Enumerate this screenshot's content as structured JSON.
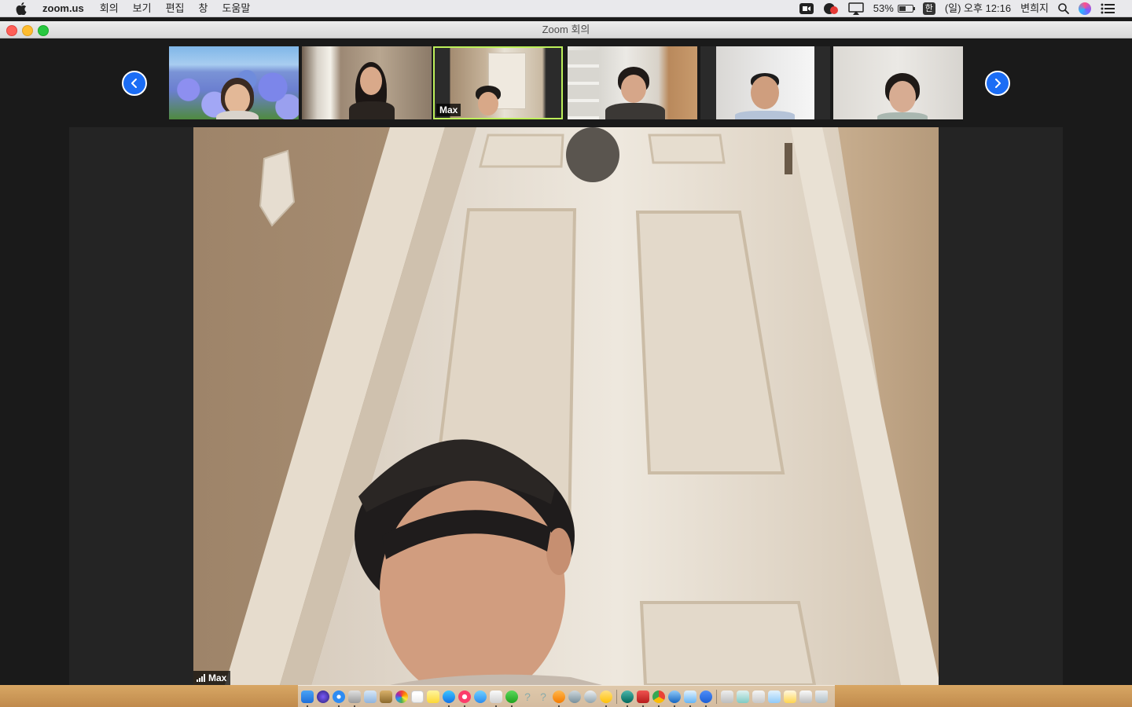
{
  "menubar": {
    "app_name": "zoom.us",
    "menus": [
      "회의",
      "보기",
      "편집",
      "창",
      "도움말"
    ],
    "battery_percent": "53%",
    "battery_level": 0.53,
    "input_method": "한",
    "clock": "(일) 오후 12:16",
    "user": "변희지"
  },
  "window": {
    "title": "Zoom 회의"
  },
  "gallery": {
    "active_participant": "Max"
  },
  "main_video": {
    "speaker_name": "Max"
  },
  "colors": {
    "accent_blue": "#1b6df5",
    "active_speaker_border": "#bdf05a",
    "background": "#1a1a1a"
  }
}
